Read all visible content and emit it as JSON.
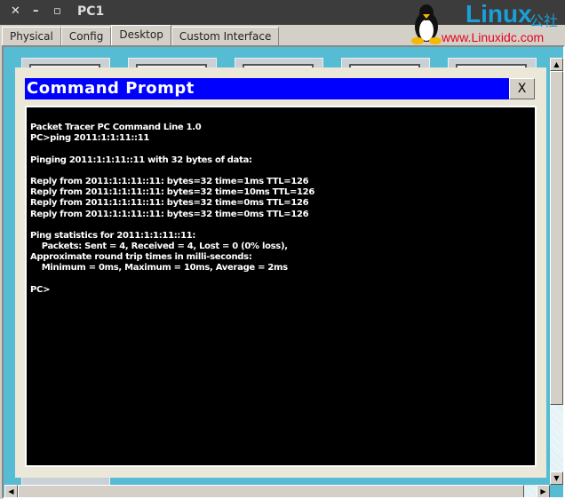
{
  "window": {
    "title": "PC1",
    "close": "✕",
    "minimize": "–",
    "maximize": "▫"
  },
  "tabs": [
    {
      "label": "Physical"
    },
    {
      "label": "Config"
    },
    {
      "label": "Desktop"
    },
    {
      "label": "Custom Interface"
    }
  ],
  "watermark": {
    "brand": "Linux",
    "brand_cn": "公社",
    "url": "www.Linuxidc.com"
  },
  "dialog": {
    "title": "Command Prompt",
    "close_label": "X"
  },
  "terminal": {
    "lines": [
      "Packet Tracer PC Command Line 1.0",
      "PC>ping 2011:1:1:11::11",
      "",
      "Pinging 2011:1:1:11::11 with 32 bytes of data:",
      "",
      "Reply from 2011:1:1:11::11: bytes=32 time=1ms TTL=126",
      "Reply from 2011:1:1:11::11: bytes=32 time=10ms TTL=126",
      "Reply from 2011:1:1:11::11: bytes=32 time=0ms TTL=126",
      "Reply from 2011:1:1:11::11: bytes=32 time=0ms TTL=126",
      "",
      "Ping statistics for 2011:1:1:11::11:",
      "    Packets: Sent = 4, Received = 4, Lost = 0 (0% loss),",
      "Approximate round trip times in milli-seconds:",
      "    Minimum = 0ms, Maximum = 10ms, Average = 2ms",
      "",
      "PC>"
    ]
  }
}
